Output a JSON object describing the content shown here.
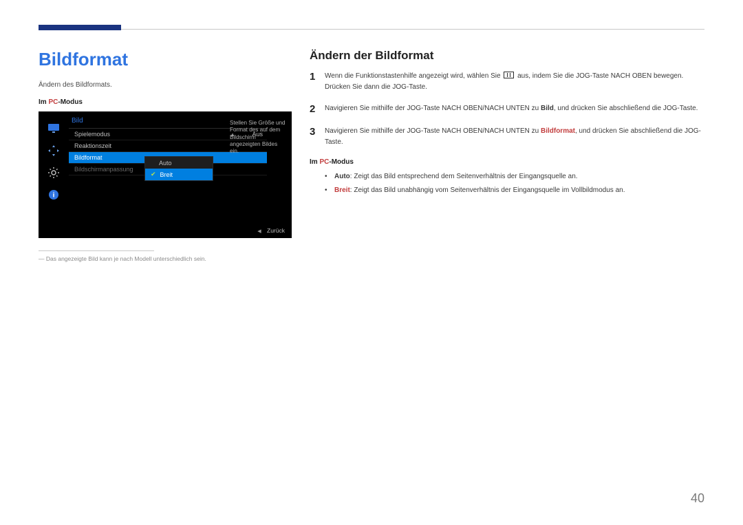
{
  "left": {
    "heading": "Bildformat",
    "desc": "Ändern des Bildformats.",
    "mode_prefix": "Im ",
    "mode_pc": "PC",
    "mode_suffix": "-Modus"
  },
  "osd": {
    "title": "Bild",
    "rows": {
      "spielemodus": {
        "label": "Spielemodus",
        "value": "Aus"
      },
      "reaktionszeit": {
        "label": "Reaktionszeit"
      },
      "bildformat": {
        "label": "Bildformat"
      },
      "anpassung": {
        "label": "Bildschirmanpassung"
      }
    },
    "submenu": {
      "auto": "Auto",
      "breit": "Breit"
    },
    "help": "Stellen Sie Größe und Format des auf dem Bildschirm angezeigten Bildes ein.",
    "back": "Zurück"
  },
  "footnote": "Das angezeigte Bild kann je nach Modell unterschiedlich sein.",
  "right": {
    "heading": "Ändern der Bildformat",
    "steps": {
      "s1a": "Wenn die Funktionstastenhilfe angezeigt wird, wählen Sie ",
      "s1b": " aus, indem Sie die JOG-Taste NACH OBEN bewegen.",
      "s1c": "Drücken Sie dann die JOG-Taste.",
      "s2a": "Navigieren Sie mithilfe der JOG-Taste NACH OBEN/NACH UNTEN zu ",
      "s2b": "Bild",
      "s2c": ", und drücken Sie abschließend die JOG-Taste.",
      "s3a": "Navigieren Sie mithilfe der JOG-Taste NACH OBEN/NACH UNTEN zu ",
      "s3b": "Bildformat",
      "s3c": ", und drücken Sie abschließend die JOG-Taste.",
      "n1": "1",
      "n2": "2",
      "n3": "3"
    },
    "mode_prefix": "Im ",
    "mode_pc": "PC",
    "mode_suffix": "-Modus",
    "bullets": {
      "auto_label": "Auto",
      "auto_text": ": Zeigt das Bild entsprechend dem Seitenverhältnis der Eingangsquelle an.",
      "breit_label": "Breit",
      "breit_text": ": Zeigt das Bild unabhängig vom Seitenverhältnis der Eingangsquelle im Vollbildmodus an."
    }
  },
  "page": "40"
}
